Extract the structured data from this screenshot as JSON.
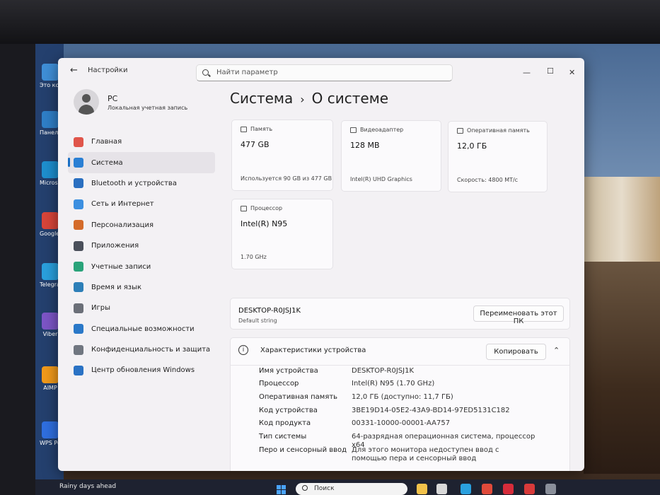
{
  "window": {
    "app_title": "Настройки",
    "back_icon": "arrow-left-icon",
    "search_placeholder": "Найти параметр",
    "controls": {
      "minimize": "—",
      "maximize": "☐",
      "close": "✕"
    }
  },
  "profile": {
    "name": "PC",
    "account_type": "Локальная учетная запись"
  },
  "sidebar": {
    "items": [
      {
        "label": "Главная",
        "icon": "home-icon",
        "color": "#e0554a"
      },
      {
        "label": "Система",
        "icon": "system-icon",
        "color": "#2a7fd4",
        "active": true
      },
      {
        "label": "Bluetooth и устройства",
        "icon": "bluetooth-icon",
        "color": "#2a6fc0"
      },
      {
        "label": "Сеть и Интернет",
        "icon": "wifi-icon",
        "color": "#3c8fe0"
      },
      {
        "label": "Персонализация",
        "icon": "brush-icon",
        "color": "#d46b2a"
      },
      {
        "label": "Приложения",
        "icon": "apps-icon",
        "color": "#4a4f5a"
      },
      {
        "label": "Учетные записи",
        "icon": "person-icon",
        "color": "#2aa37a"
      },
      {
        "label": "Время и язык",
        "icon": "globe-clock-icon",
        "color": "#2d7fb8"
      },
      {
        "label": "Игры",
        "icon": "gamepad-icon",
        "color": "#6b6f78"
      },
      {
        "label": "Специальные возможности",
        "icon": "accessibility-icon",
        "color": "#2a78c8"
      },
      {
        "label": "Конфиденциальность и защита",
        "icon": "shield-icon",
        "color": "#707680"
      },
      {
        "label": "Центр обновления Windows",
        "icon": "update-icon",
        "color": "#2a72c4"
      }
    ]
  },
  "breadcrumb": {
    "parent": "Система",
    "separator": "›",
    "current": "О системе"
  },
  "cards": [
    {
      "label": "Память",
      "icon": "storage-icon",
      "value": "477 GB",
      "sub": "Используется 90 GB из 477 GB"
    },
    {
      "label": "Видеоадаптер",
      "icon": "gpu-icon",
      "value": "128 MB",
      "sub": "Intel(R) UHD Graphics"
    },
    {
      "label": "Оперативная память",
      "icon": "ram-icon",
      "value": "12,0 ГБ",
      "sub": "Скорость: 4800 MT/c"
    },
    {
      "label": "Процессор",
      "icon": "cpu-icon",
      "value": "Intel(R) N95",
      "sub": "1.70 GHz"
    }
  ],
  "device": {
    "name": "DESKTOP-R0JSJ1K",
    "sub": "Default string",
    "rename_label": "Переименовать этот ПК"
  },
  "specs": {
    "title": "Характеристики устройства",
    "copy_label": "Копировать",
    "rows": [
      {
        "key": "Имя устройства",
        "value": "DESKTOP-R0JSJ1K"
      },
      {
        "key": "Процессор",
        "value": "Intel(R) N95 (1.70 GHz)"
      },
      {
        "key": "Оперативная память",
        "value": "12,0 ГБ (доступно: 11,7 ГБ)"
      },
      {
        "key": "Код устройства",
        "value": "3BE19D14-05E2-43A9-BD14-97ED5131C182"
      },
      {
        "key": "Код продукта",
        "value": "00331-10000-00001-AA757"
      },
      {
        "key": "Тип системы",
        "value": "64-разрядная операционная система, процессор x64"
      },
      {
        "key": "Перо и сенсорный ввод",
        "value": "Для этого монитора недоступен ввод с помощью пера и сенсорный ввод"
      }
    ]
  },
  "desktop_icons": [
    {
      "label": "Это компью",
      "color": "#3f8fd8"
    },
    {
      "label": "Панель управл",
      "color": "#2f7fc8"
    },
    {
      "label": "Microsoft Edge",
      "color": "#1e8fcf"
    },
    {
      "label": "Google Chrome",
      "color": "#d9453a"
    },
    {
      "label": "Telegram",
      "color": "#2aa0de"
    },
    {
      "label": "Viber",
      "color": "#7d55c7"
    },
    {
      "label": "AIMP",
      "color": "#f29a1b"
    },
    {
      "label": "WPS Pdf",
      "color": "#2f6fe0"
    }
  ],
  "taskbar": {
    "weather": "Rainy days ahead",
    "search": "Поиск",
    "apps": [
      {
        "name": "file-explorer-icon",
        "color": "#f2c24a"
      },
      {
        "name": "wps-icon",
        "color": "#d9d9d9"
      },
      {
        "name": "telegram-icon",
        "color": "#2aa0de"
      },
      {
        "name": "chrome-icon",
        "color": "#e04a3a"
      },
      {
        "name": "opera-icon",
        "color": "#d62c3a"
      },
      {
        "name": "wps-office-icon",
        "color": "#d83a3a"
      },
      {
        "name": "settings-icon",
        "color": "#8a8f9a"
      }
    ]
  }
}
